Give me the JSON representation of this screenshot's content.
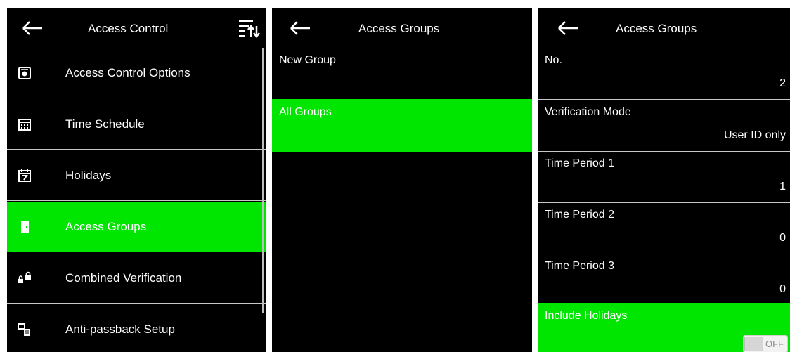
{
  "screen1": {
    "title": "Access Control",
    "menu": [
      {
        "label": "Access Control Options",
        "icon": "options-icon"
      },
      {
        "label": "Time Schedule",
        "icon": "calendar-icon"
      },
      {
        "label": "Holidays",
        "icon": "holiday-calendar-icon"
      },
      {
        "label": "Access Groups",
        "icon": "door-icon",
        "selected": true
      },
      {
        "label": "Combined Verification",
        "icon": "locks-icon"
      },
      {
        "label": "Anti-passback Setup",
        "icon": "anti-passback-icon"
      }
    ]
  },
  "screen2": {
    "title": "Access Groups",
    "items": [
      {
        "label": "New Group"
      },
      {
        "label": "All Groups",
        "selected": true
      }
    ]
  },
  "screen3": {
    "title": "Access Groups",
    "fields": [
      {
        "label": "No.",
        "value": "2"
      },
      {
        "label": "Verification Mode",
        "value": "User ID only"
      },
      {
        "label": "Time Period 1",
        "value": "1"
      },
      {
        "label": "Time Period 2",
        "value": "0"
      },
      {
        "label": "Time Period 3",
        "value": "0"
      },
      {
        "label": "Include Holidays",
        "toggle": "OFF",
        "selected": true
      }
    ]
  },
  "colors": {
    "highlight": "#00e600",
    "background": "#000000",
    "text": "#ffffff"
  }
}
